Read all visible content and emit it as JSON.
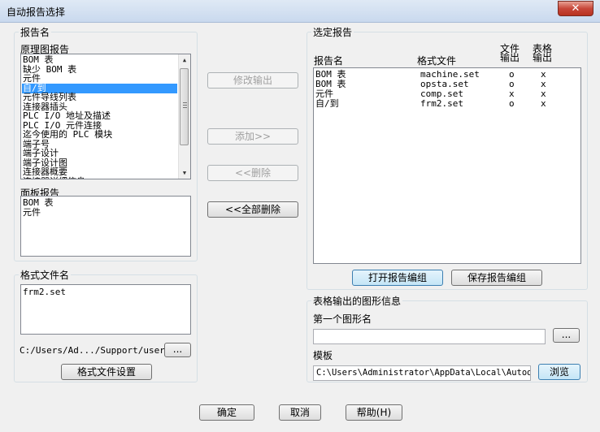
{
  "window": {
    "title": "自动报告选择",
    "close_icon": "✕"
  },
  "report_name_group": {
    "label": "报告名",
    "schematic_label": "原理图报告",
    "schematic_items": [
      "BOM 表",
      "缺少 BOM 表",
      "元件",
      "自/到",
      "元件导线列表",
      "连接器插头",
      "PLC I/O 地址及描述",
      "PLC I/O 元件连接",
      "迄今使用的 PLC 模块",
      "端子号",
      "端子设计",
      "端子设计图",
      "连接器概要",
      "连接器详细信息"
    ],
    "schematic_selected": "自/到",
    "panel_label": "面板报告",
    "panel_items": [
      "BOM 表",
      "元件"
    ]
  },
  "format_file_group": {
    "label": "格式文件名",
    "items": [
      "frm2.set"
    ],
    "path": "C:/Users/Ad.../Support/user/",
    "browse_label": "...",
    "settings_label": "格式文件设置"
  },
  "middle_buttons": {
    "modify_output": "修改输出",
    "add": "添加>>",
    "delete": "<<删除",
    "delete_all": "<<全部删除"
  },
  "selected_reports": {
    "label": "选定报告",
    "headers": {
      "name": "报告名",
      "format": "格式文件",
      "file_output": [
        "文件",
        "输出"
      ],
      "table_output": [
        "表格",
        "输出"
      ]
    },
    "rows": [
      {
        "name": "BOM 表",
        "format": "machine.set",
        "file": "o",
        "table": "x"
      },
      {
        "name": "BOM 表",
        "format": "opsta.set",
        "file": "o",
        "table": "x"
      },
      {
        "name": "元件",
        "format": "comp.set",
        "file": "x",
        "table": "x"
      },
      {
        "name": "自/到",
        "format": "frm2.set",
        "file": "o",
        "table": "x"
      }
    ],
    "open_group_label": "打开报告编组",
    "save_group_label": "保存报告编组"
  },
  "table_graphics": {
    "label": "表格输出的图形信息",
    "first_name_label": "第一个图形名",
    "first_name_value": "",
    "first_browse_label": "...",
    "template_label": "模板",
    "template_value": "C:\\Users\\Administrator\\AppData\\Local\\Autodes",
    "template_browse_label": "浏览"
  },
  "footer": {
    "ok": "确定",
    "cancel": "取消",
    "help": "帮助(H)"
  }
}
